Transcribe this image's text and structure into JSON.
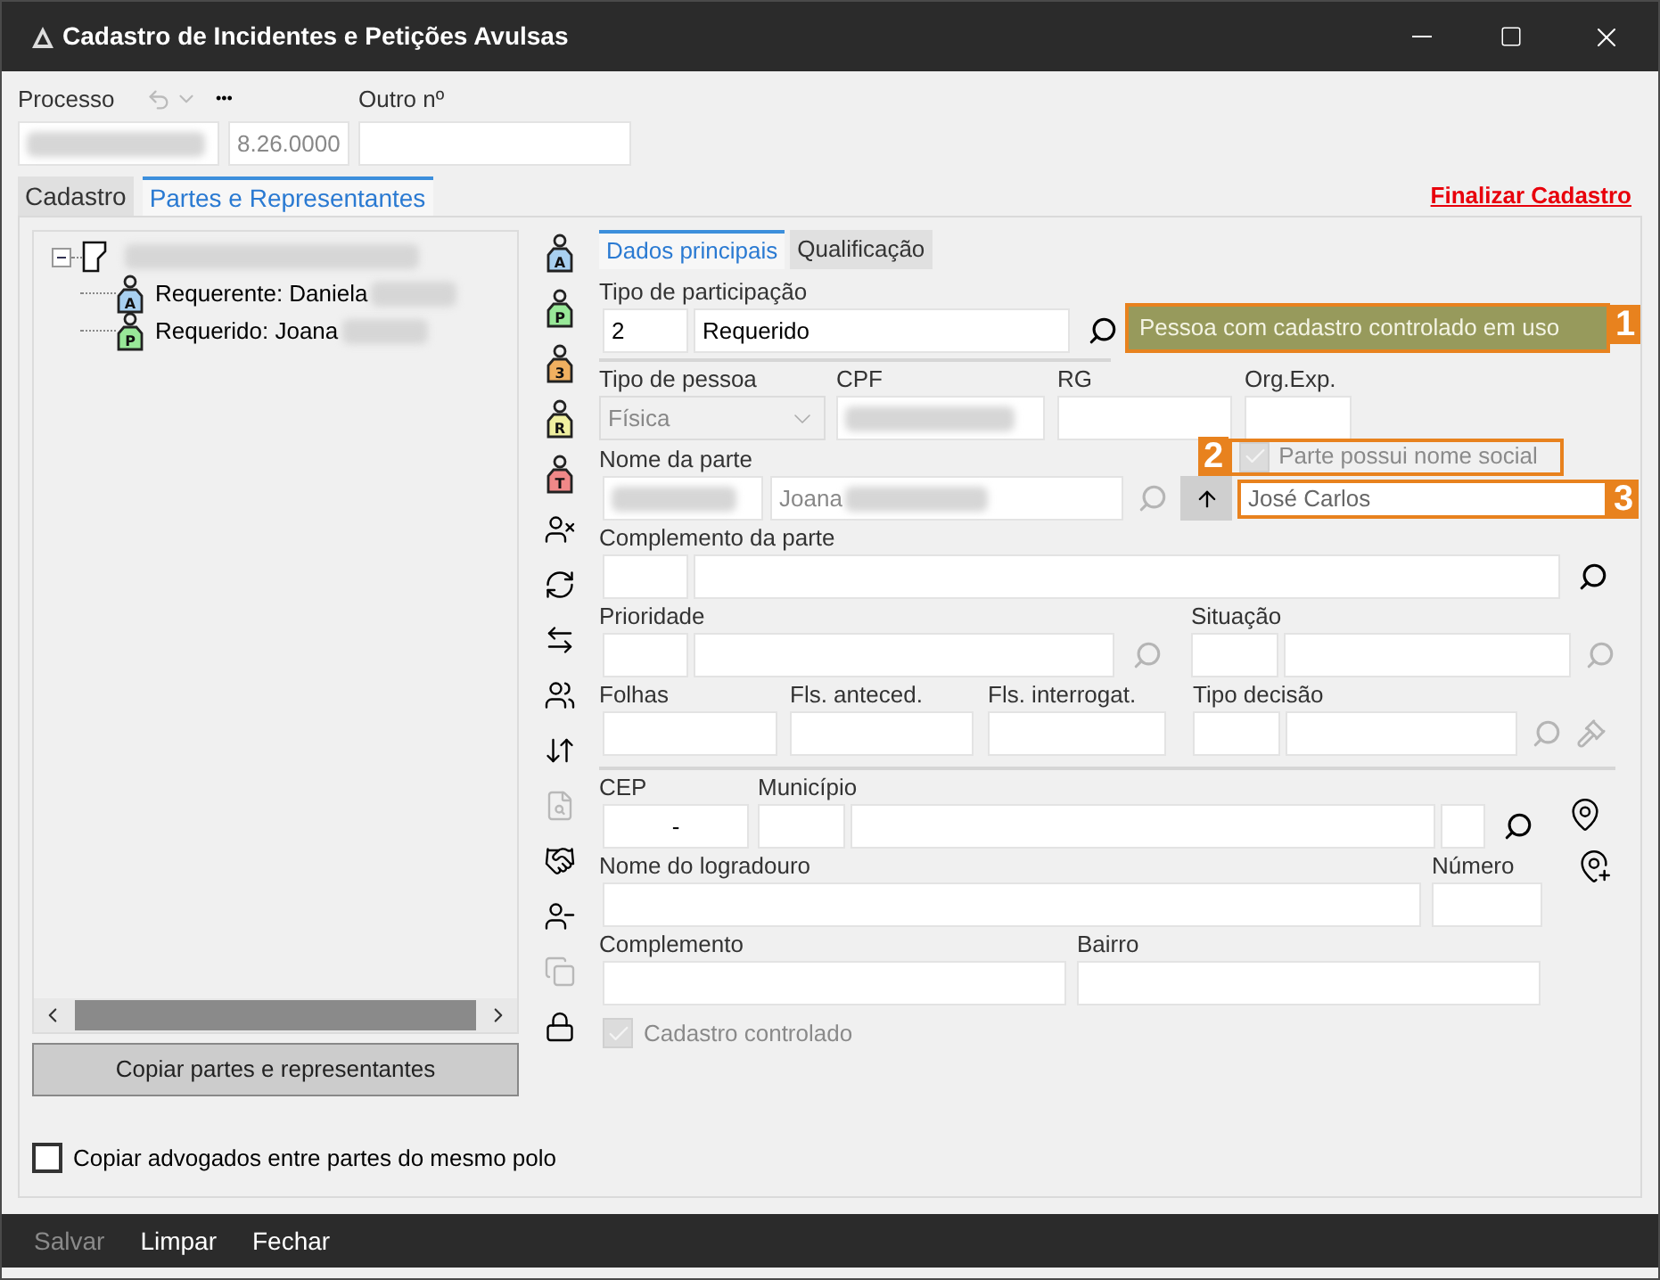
{
  "window": {
    "title": "Cadastro de Incidentes e Petições Avulsas"
  },
  "header": {
    "process_label": "Processo",
    "more": "•••",
    "process_number": "8.26.0000",
    "other_label": "Outro nº"
  },
  "tabs": [
    {
      "label": "Cadastro",
      "selected": false
    },
    {
      "label": "Partes e Representantes",
      "selected": true
    }
  ],
  "finalize_link": "Finalizar Cadastro",
  "tree": {
    "expanded": true,
    "children": [
      {
        "label": "Requerente: Daniela",
        "letter": "A",
        "color": "#a8d0f0"
      },
      {
        "label": "Requerido: Joana",
        "letter": "P",
        "color": "#98e898"
      }
    ]
  },
  "copy_button": "Copiar partes e representantes",
  "copy_lawyers": {
    "label": "Copiar advogados entre partes do mesmo polo",
    "checked": false
  },
  "role_tools": [
    {
      "kind": "tag",
      "letter": "A",
      "color": "#a8d0f0",
      "disabled": false
    },
    {
      "kind": "tag",
      "letter": "P",
      "color": "#98e898",
      "disabled": false
    },
    {
      "kind": "tag",
      "letter": "3",
      "color": "#f0b060",
      "disabled": false
    },
    {
      "kind": "tag",
      "letter": "R",
      "color": "#f0f0a0",
      "disabled": false
    },
    {
      "kind": "tag",
      "letter": "T",
      "color": "#f08888",
      "disabled": false
    },
    {
      "kind": "remove",
      "disabled": false
    },
    {
      "kind": "rotate",
      "disabled": false
    },
    {
      "kind": "exchange",
      "disabled": false
    },
    {
      "kind": "group",
      "disabled": false
    },
    {
      "kind": "sort",
      "disabled": false
    },
    {
      "kind": "document",
      "disabled": true
    },
    {
      "kind": "handshake",
      "disabled": false
    },
    {
      "kind": "unlink",
      "disabled": false
    },
    {
      "kind": "copy",
      "disabled": true
    },
    {
      "kind": "lock",
      "disabled": false
    }
  ],
  "subtabs": [
    {
      "label": "Dados principais",
      "selected": true
    },
    {
      "label": "Qualificação",
      "selected": false
    }
  ],
  "form": {
    "participation": {
      "label": "Tipo de participação",
      "code": "2",
      "value": "Requerido",
      "search_enabled": true
    },
    "status_badge": {
      "text": "Pessoa com cadastro controlado em uso",
      "callout": "1"
    },
    "person_type": {
      "label": "Tipo de pessoa",
      "value": "Física",
      "disabled": true
    },
    "cpf": {
      "label": "CPF"
    },
    "rg": {
      "label": "RG"
    },
    "issuer": {
      "label": "Org.Exp."
    },
    "party_name": {
      "label": "Nome da parte",
      "value": "Joana",
      "search_enabled": false
    },
    "social_name_flag": {
      "label": "Parte possui nome social",
      "checked": true,
      "disabled": true,
      "callout": "2"
    },
    "social_name": {
      "value": "José Carlos",
      "callout": "3"
    },
    "party_complement": {
      "label": "Complemento da parte",
      "search_enabled": true
    },
    "priority": {
      "label": "Prioridade",
      "search_enabled": false
    },
    "situation": {
      "label": "Situação",
      "search_enabled": false
    },
    "pages": {
      "label": "Folhas"
    },
    "prior_pages": {
      "label": "Fls. anteced."
    },
    "interrog_pages": {
      "label": "Fls. interrogat."
    },
    "decision_type": {
      "label": "Tipo decisão",
      "search_enabled": false
    },
    "zip": {
      "label": "CEP",
      "value": "-"
    },
    "city": {
      "label": "Município",
      "search_enabled": true
    },
    "street": {
      "label": "Nome do logradouro"
    },
    "number": {
      "label": "Número"
    },
    "complement": {
      "label": "Complemento"
    },
    "district": {
      "label": "Bairro"
    },
    "controlled": {
      "label": "Cadastro controlado",
      "checked": true,
      "disabled": true
    }
  },
  "footer": [
    {
      "label": "Salvar",
      "disabled": true
    },
    {
      "label": "Limpar",
      "disabled": false
    },
    {
      "label": "Fechar",
      "disabled": false
    }
  ]
}
